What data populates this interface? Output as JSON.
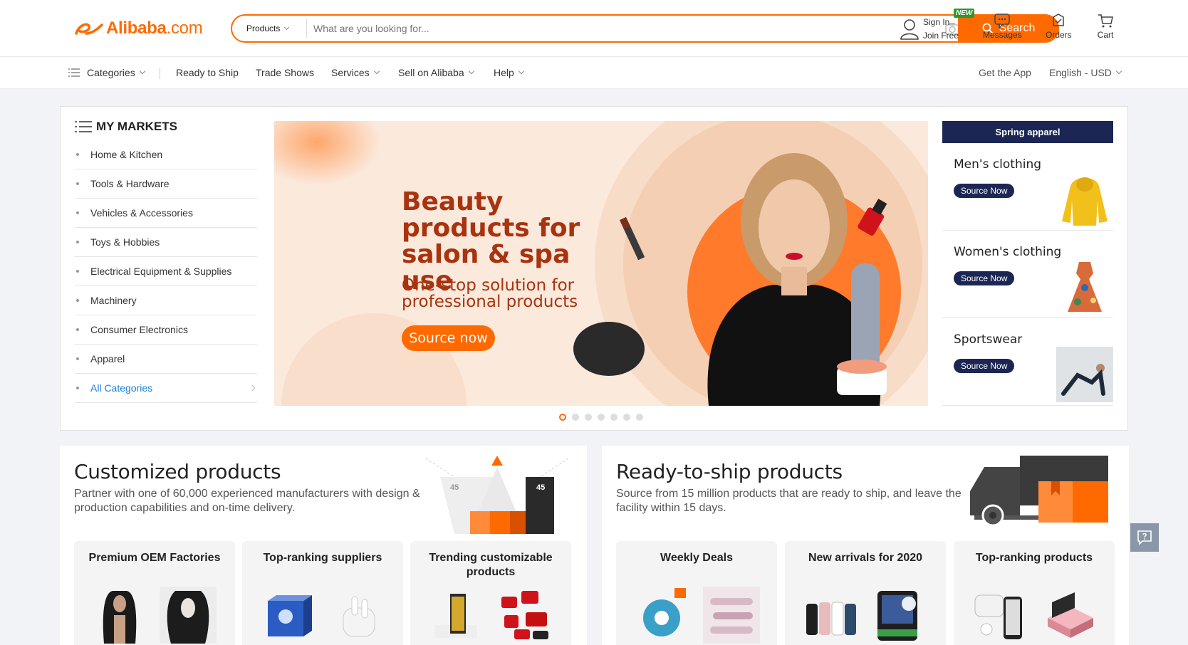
{
  "header": {
    "logo_text": "Alibaba",
    "logo_suffix": ".com",
    "search_category": "Products",
    "search_placeholder": "What are you looking for...",
    "search_button": "Search",
    "sign_in": "Sign In",
    "join_free": "Join Free",
    "new_badge": "NEW",
    "messages": "Messages",
    "orders": "Orders",
    "cart": "Cart"
  },
  "nav": {
    "categories": "Categories",
    "ready_to_ship": "Ready to Ship",
    "trade_shows": "Trade Shows",
    "services": "Services",
    "sell": "Sell on Alibaba",
    "help": "Help",
    "get_app": "Get the App",
    "language": "English - USD"
  },
  "markets": {
    "title": "MY MARKETS",
    "items": [
      "Home & Kitchen",
      "Tools & Hardware",
      "Vehicles & Accessories",
      "Toys & Hobbies",
      "Electrical Equipment & Supplies",
      "Machinery",
      "Consumer Electronics",
      "Apparel"
    ],
    "all": "All Categories"
  },
  "banner": {
    "headline": "Beauty products for salon & spa use",
    "subline": "One-stop solution for professional products",
    "cta": "Source now",
    "slides": 7,
    "active_slide": 1
  },
  "spring": {
    "title": "Spring apparel",
    "cards": [
      {
        "name": "Men's clothing",
        "cta": "Source Now"
      },
      {
        "name": "Women's clothing",
        "cta": "Source Now"
      },
      {
        "name": "Sportswear",
        "cta": "Source Now"
      }
    ]
  },
  "customized": {
    "title": "Customized products",
    "desc": "Partner with one of 60,000 experienced manufacturers with design & production capabilities and on-time delivery.",
    "graphic_labels": [
      "45",
      "45"
    ],
    "cards": [
      "Premium OEM Factories",
      "Top-ranking suppliers",
      "Trending customizable products"
    ]
  },
  "ready": {
    "title": "Ready-to-ship products",
    "desc": "Source from 15 million products that are ready to ship, and leave the facility within 15 days.",
    "cards": [
      "Weekly Deals",
      "New arrivals for 2020",
      "Top-ranking products"
    ]
  },
  "colors": {
    "brand": "#ff6a00",
    "navy": "#1c2654",
    "banner_text": "#a8330e"
  }
}
